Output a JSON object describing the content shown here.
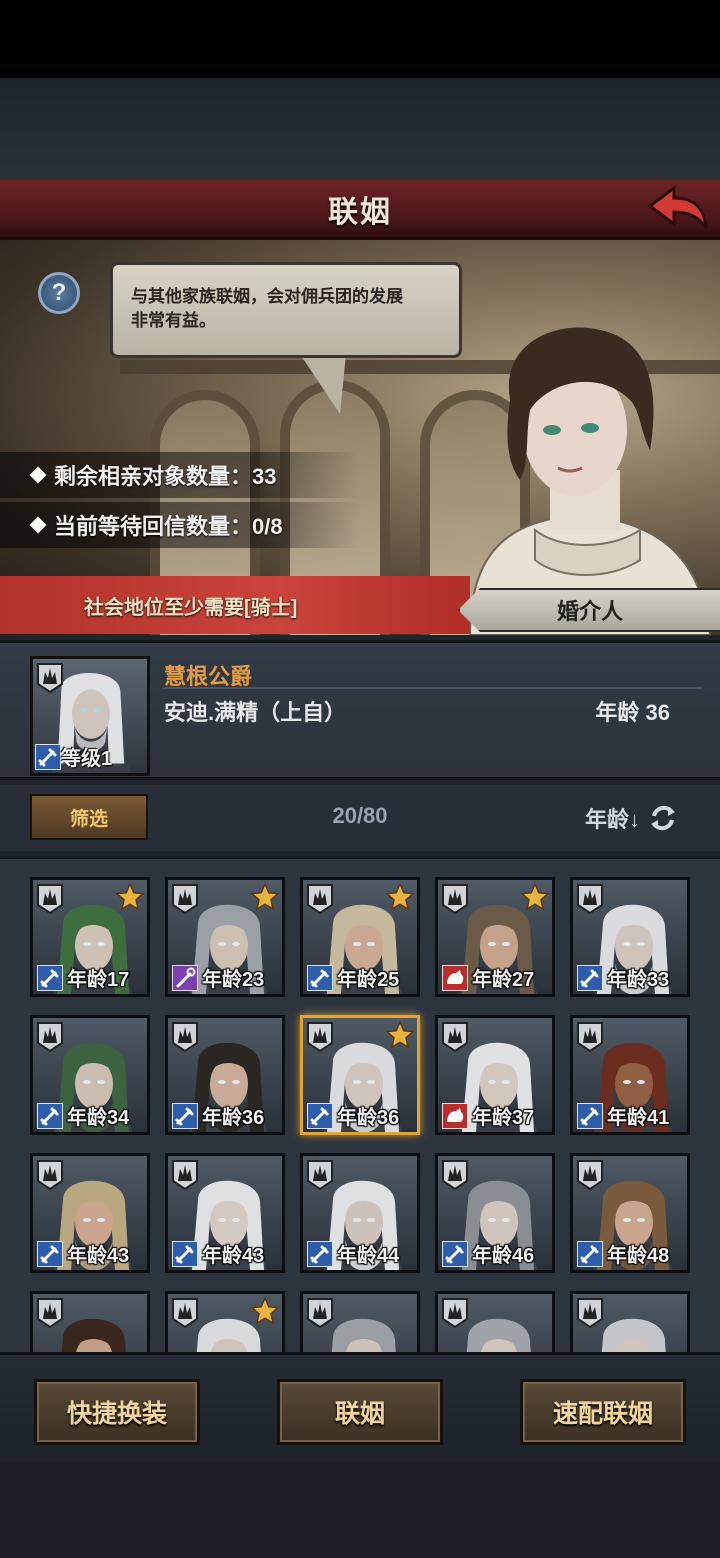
{
  "header": {
    "title": "联姻"
  },
  "dialog": {
    "text_line1": "与其他家族联姻，会对佣兵团的发展",
    "text_line2": "非常有益。",
    "help_glyph": "?"
  },
  "stats": {
    "remaining_label": "剩余相亲对象数量：33",
    "waiting_label": "当前等待回信数量：0/8"
  },
  "requirement": "社会地位至少需要[骑士]",
  "matchmaker_label": "婚介人",
  "character": {
    "title": "慧根公爵",
    "name": "安迪.满精（上自）",
    "age": "年龄 36",
    "level": "等级1"
  },
  "filter": {
    "button": "筛选",
    "count": "20/80",
    "sort_label": "年龄↓"
  },
  "candidates": [
    {
      "age": "年龄17",
      "star": true,
      "cls": "sword",
      "hair": "#3f6e3e",
      "skin": "#cfc2b4",
      "beard": false
    },
    {
      "age": "年龄23",
      "star": true,
      "cls": "staff",
      "hair": "#9aa0a6",
      "skin": "#cdbfb2",
      "beard": false
    },
    {
      "age": "年龄25",
      "star": true,
      "cls": "sword",
      "hair": "#c6b89a",
      "skin": "#c9a992",
      "beard": false
    },
    {
      "age": "年龄27",
      "star": true,
      "cls": "beast",
      "hair": "#6a5a47",
      "skin": "#c4a38a",
      "beard": false
    },
    {
      "age": "年龄33",
      "star": false,
      "cls": "sword",
      "hair": "#d9dbde",
      "skin": "#cfc4bb",
      "beard": true
    },
    {
      "age": "年龄34",
      "star": false,
      "cls": "sword",
      "hair": "#3c6240",
      "skin": "#cbbeb1",
      "beard": true
    },
    {
      "age": "年龄36",
      "star": false,
      "cls": "sword",
      "hair": "#2a2622",
      "skin": "#c7ab96",
      "beard": true
    },
    {
      "age": "年龄36",
      "star": true,
      "cls": "sword",
      "hair": "#d9dbde",
      "skin": "#cfc4bb",
      "beard": true,
      "selected": true
    },
    {
      "age": "年龄37",
      "star": false,
      "cls": "beast",
      "hair": "#e0e1e3",
      "skin": "#d2c7bd",
      "beard": false
    },
    {
      "age": "年龄41",
      "star": false,
      "cls": "sword",
      "hair": "#6a2d1f",
      "skin": "#8f5e43",
      "beard": true
    },
    {
      "age": "年龄43",
      "star": false,
      "cls": "sword",
      "hair": "#b8a77f",
      "skin": "#c8a58c",
      "beard": true
    },
    {
      "age": "年龄43",
      "star": false,
      "cls": "sword",
      "hair": "#dfe0e2",
      "skin": "#d3c9c0",
      "beard": false
    },
    {
      "age": "年龄44",
      "star": false,
      "cls": "sword",
      "hair": "#dfe0e2",
      "skin": "#cdc2b9",
      "beard": true
    },
    {
      "age": "年龄46",
      "star": false,
      "cls": "sword",
      "hair": "#8a8d91",
      "skin": "#d0c5bc",
      "beard": false
    },
    {
      "age": "年龄48",
      "star": false,
      "cls": "sword",
      "hair": "#7a5a3c",
      "skin": "#c8a58c",
      "beard": true
    },
    {
      "age": "",
      "star": false,
      "cls": "",
      "hair": "#3a261c",
      "skin": "#c19c86",
      "beard": false
    },
    {
      "age": "",
      "star": true,
      "cls": "",
      "hair": "#d8d9db",
      "skin": "#cfc4bb",
      "beard": false
    },
    {
      "age": "",
      "star": false,
      "cls": "",
      "hair": "#9b9ea2",
      "skin": "#cdc2b9",
      "beard": false
    },
    {
      "age": "",
      "star": false,
      "cls": "",
      "hair": "#a0a3a7",
      "skin": "#cfc4bb",
      "beard": false
    },
    {
      "age": "",
      "star": false,
      "cls": "",
      "hair": "#c3c5c8",
      "skin": "#cfc4bb",
      "beard": false
    }
  ],
  "actions": {
    "quick_equip": "快捷换装",
    "marry": "联姻",
    "quick_match": "速配联姻"
  },
  "colors": {
    "title_bar": "#6e2427",
    "requirement_bar": "#c9443a",
    "accent_orange": "#e69a3c",
    "selected_border": "#e0a633"
  }
}
